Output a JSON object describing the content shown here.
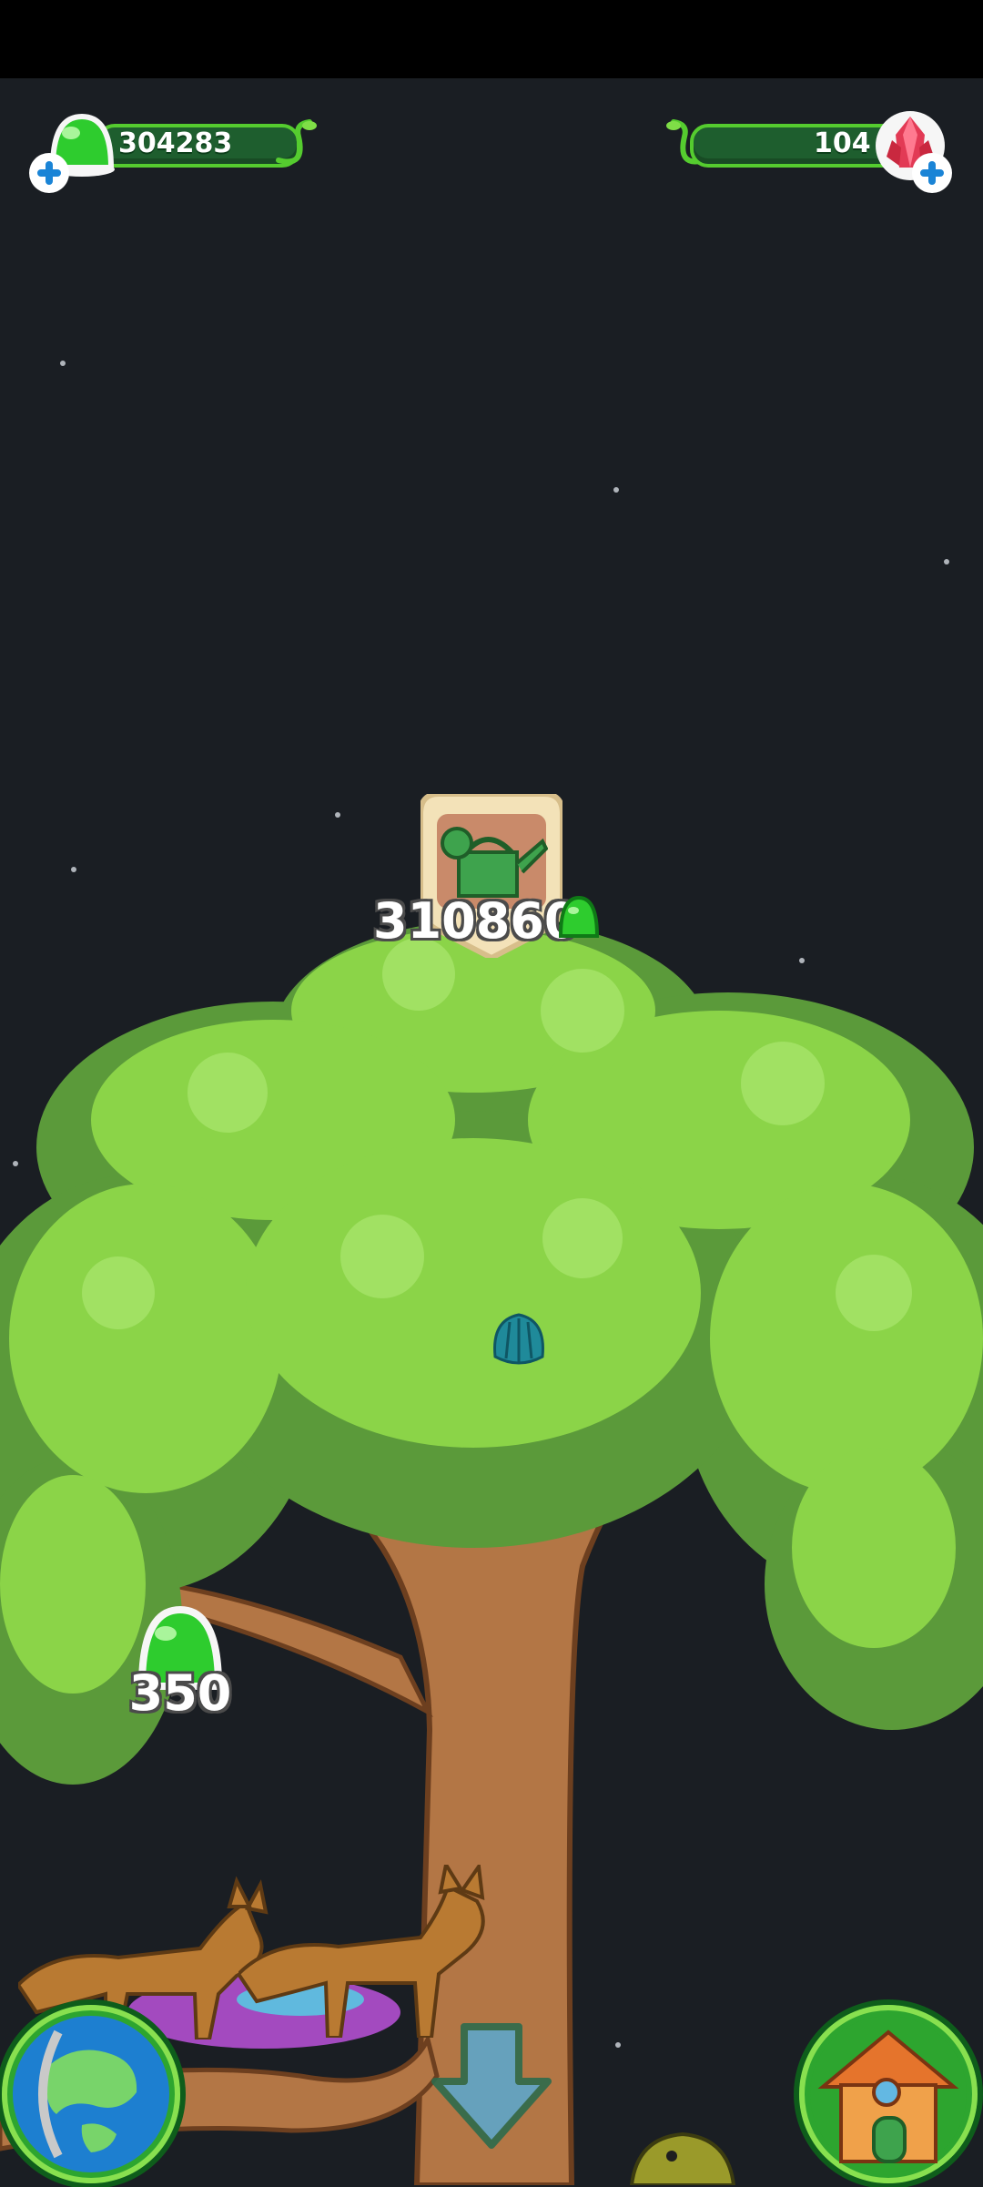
{
  "hud": {
    "gum_count": "304283",
    "gem_count": "104"
  },
  "tree": {
    "upgrade_cost": "310860",
    "gum_drop_value": "350"
  },
  "icons": {
    "gum": "gum-drop-icon",
    "gem": "red-gem-icon",
    "add": "plus-icon",
    "watering_can": "watering-can-icon",
    "globe": "globe-icon",
    "house": "house-icon",
    "down_arrow": "arrow-down-icon"
  },
  "colors": {
    "background": "#1a1e23",
    "hud_bar": "#1e5e2e",
    "hud_border": "#55cc2f",
    "gum_green": "#2ecc2e",
    "leaf": "#8bd448",
    "leaf_dark": "#5b9a3a",
    "trunk": "#b37645"
  }
}
